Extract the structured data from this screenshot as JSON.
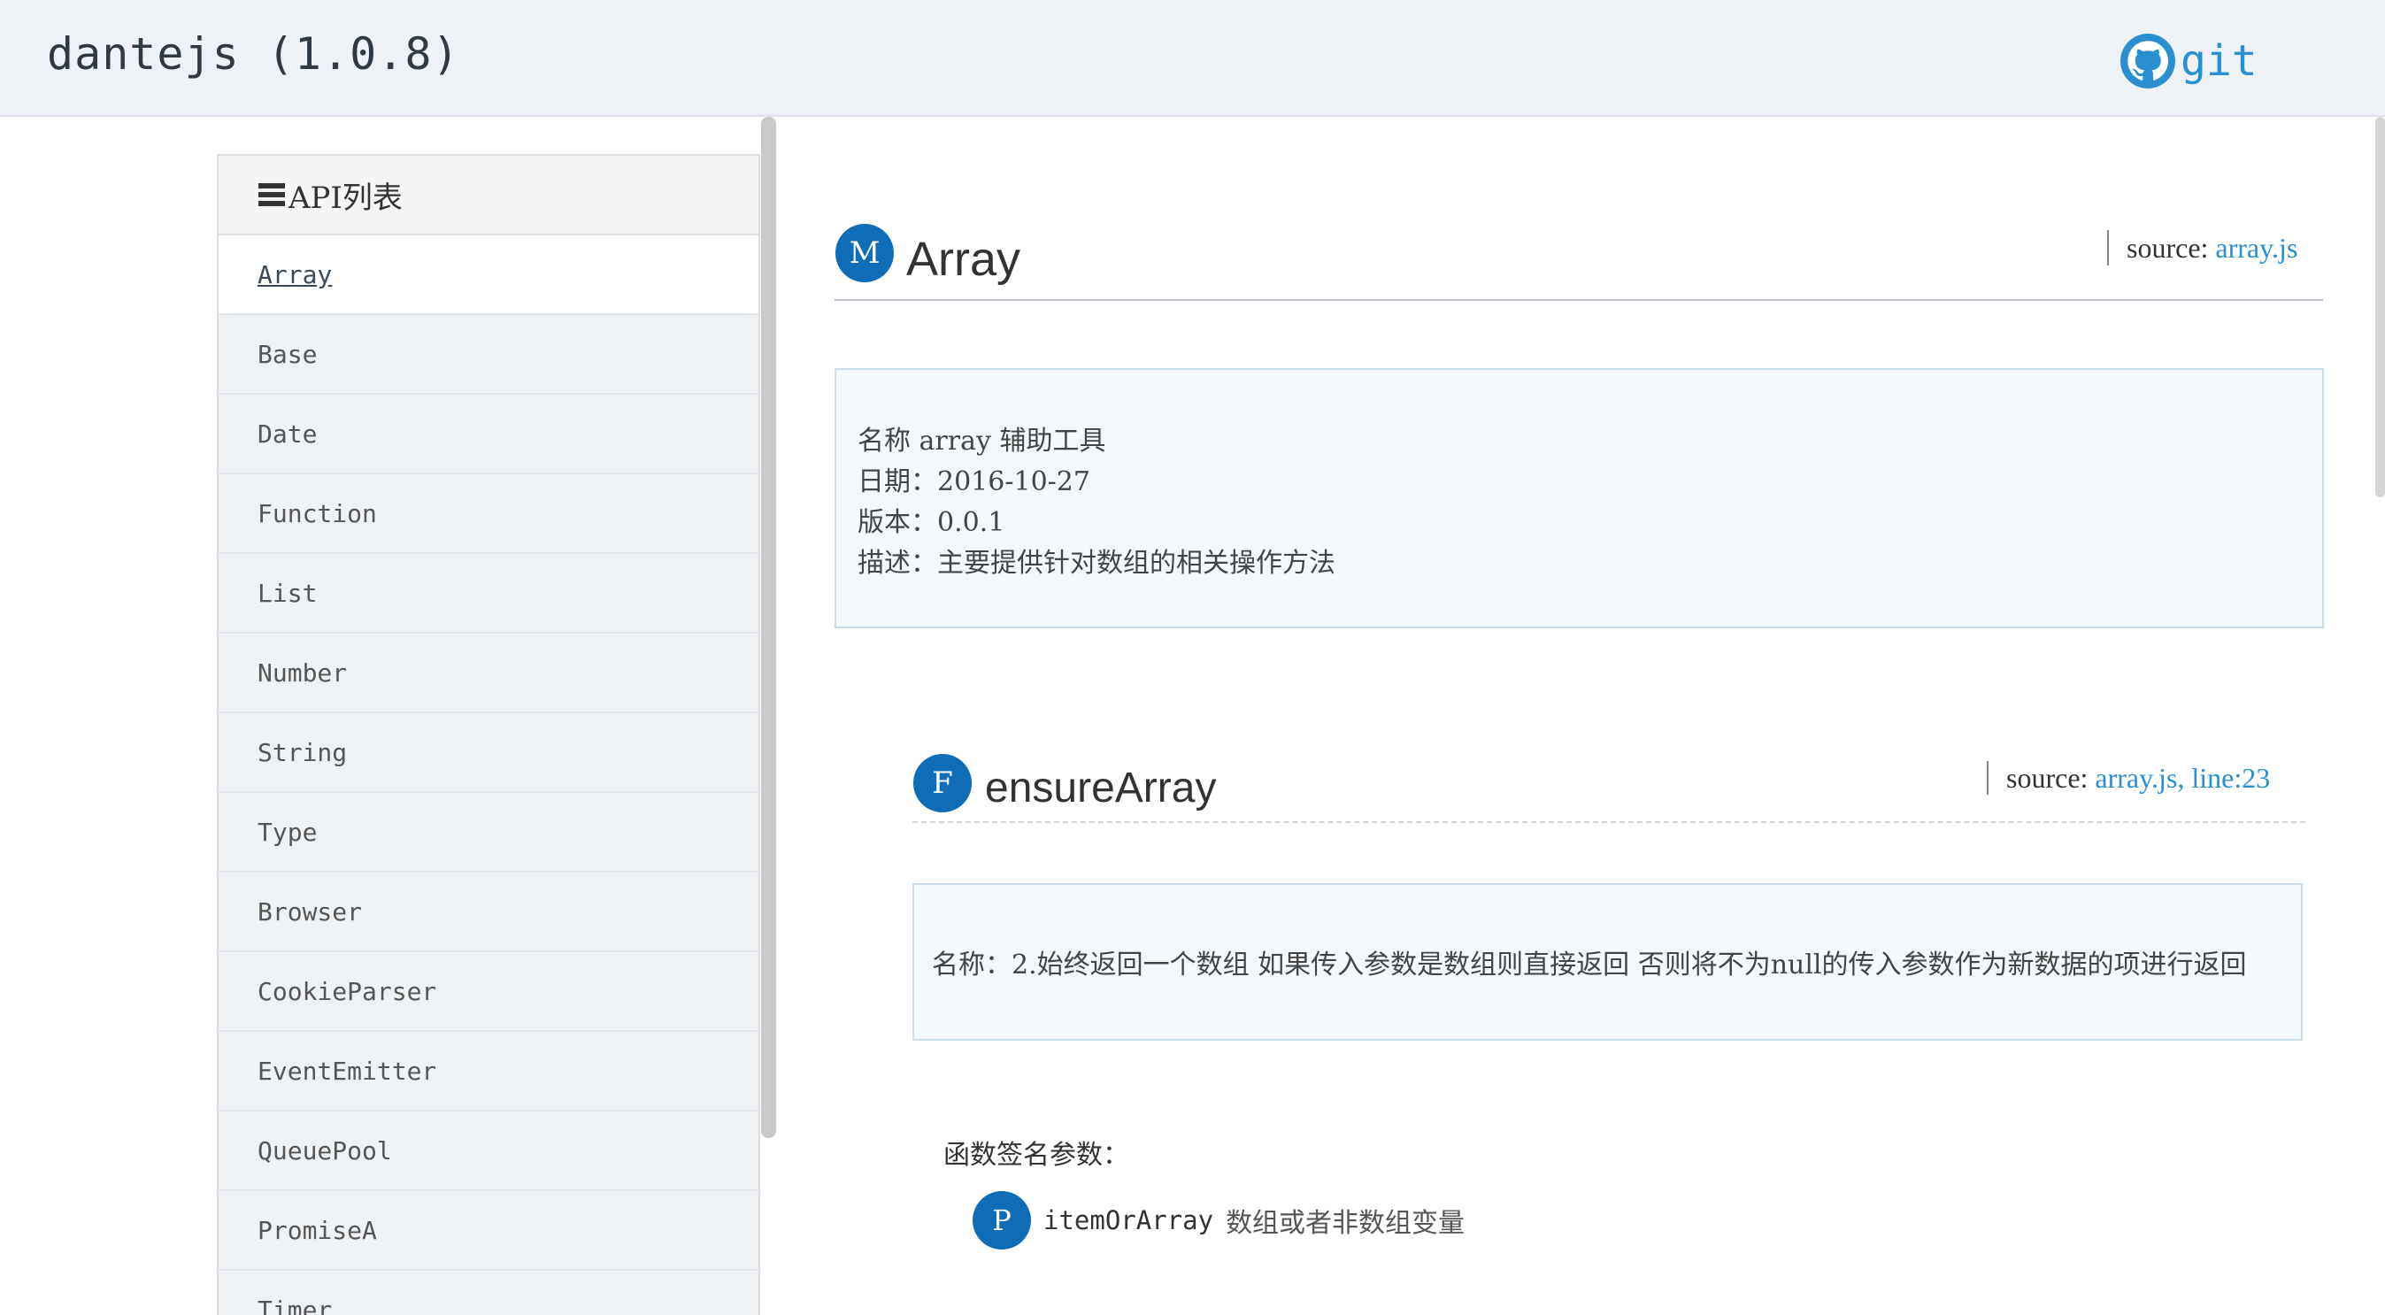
{
  "header": {
    "title": "dantejs (1.0.8)",
    "git_label": "git",
    "git_icon": "github-icon"
  },
  "sidebar": {
    "heading_icon": "list-icon",
    "heading": "API列表",
    "items": [
      {
        "label": "Array",
        "active": true
      },
      {
        "label": "Base"
      },
      {
        "label": "Date"
      },
      {
        "label": "Function"
      },
      {
        "label": "List"
      },
      {
        "label": "Number"
      },
      {
        "label": "String"
      },
      {
        "label": "Type"
      },
      {
        "label": "Browser"
      },
      {
        "label": "CookieParser"
      },
      {
        "label": "EventEmitter"
      },
      {
        "label": "QueuePool"
      },
      {
        "label": "PromiseA"
      },
      {
        "label": "Timer"
      }
    ]
  },
  "module": {
    "badge": "M",
    "name": "Array",
    "source_label": "source:",
    "source_link": "array.js",
    "info": {
      "name_line": "名称 array 辅助工具",
      "date_line": "日期：2016-10-27",
      "version_line": "版本：0.0.1",
      "desc_line": "描述：主要提供针对数组的相关操作方法"
    }
  },
  "function": {
    "badge": "F",
    "name": "ensureArray",
    "source_label": "source:",
    "source_link": "array.js, line:23",
    "description": "名称：2.始终返回一个数组 如果传入参数是数组则直接返回 否则将不为null的传入参数作为新数据的项进行返回",
    "signature_label": "函数签名参数：",
    "params": [
      {
        "badge": "P",
        "name": "itemOrArray",
        "desc": "数组或者非数组变量"
      }
    ]
  },
  "colors": {
    "accent": "#0f6cb6",
    "link": "#2a8fd1",
    "topbar": "#eef2f6",
    "infobox_bg": "#f2f8fb"
  }
}
